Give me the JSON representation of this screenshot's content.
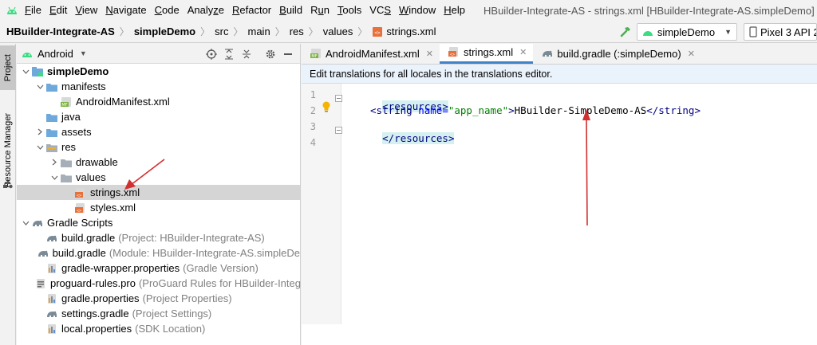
{
  "menubar": {
    "items": [
      {
        "label": "File",
        "u": "F"
      },
      {
        "label": "Edit",
        "u": "E"
      },
      {
        "label": "View",
        "u": "V"
      },
      {
        "label": "Navigate",
        "u": "N"
      },
      {
        "label": "Code",
        "u": "C"
      },
      {
        "label": "Analyze",
        "u": "z"
      },
      {
        "label": "Refactor",
        "u": "R"
      },
      {
        "label": "Build",
        "u": "B"
      },
      {
        "label": "Run",
        "u": "u"
      },
      {
        "label": "Tools",
        "u": "T"
      },
      {
        "label": "VCS",
        "u": "S"
      },
      {
        "label": "Window",
        "u": "W"
      },
      {
        "label": "Help",
        "u": "H"
      }
    ],
    "window_title": "HBuilder-Integrate-AS - strings.xml [HBuilder-Integrate-AS.simpleDemo]"
  },
  "navbar": {
    "crumbs": [
      "HBuilder-Integrate-AS",
      "simpleDemo",
      "src",
      "main",
      "res",
      "values",
      "strings.xml"
    ],
    "run_config": "simpleDemo",
    "device": "Pixel 3 API 2"
  },
  "stripe": {
    "project": "Project",
    "resource_manager": "Resource Manager"
  },
  "project_panel": {
    "view": "Android",
    "tree": [
      {
        "label": "simpleDemo",
        "level": 0,
        "arrow": "down",
        "icon": "module",
        "bold": true
      },
      {
        "label": "manifests",
        "level": 1,
        "arrow": "down",
        "icon": "folder"
      },
      {
        "label": "AndroidManifest.xml",
        "level": 2,
        "arrow": "",
        "icon": "manifest"
      },
      {
        "label": "java",
        "level": 1,
        "arrow": "",
        "icon": "folder"
      },
      {
        "label": "assets",
        "level": 1,
        "arrow": "right",
        "icon": "folder"
      },
      {
        "label": "res",
        "level": 1,
        "arrow": "down",
        "icon": "res-folder"
      },
      {
        "label": "drawable",
        "level": 2,
        "arrow": "right",
        "icon": "folder-gray"
      },
      {
        "label": "values",
        "level": 2,
        "arrow": "down",
        "icon": "folder-gray"
      },
      {
        "label": "strings.xml",
        "level": 3,
        "arrow": "",
        "icon": "xml",
        "selected": true
      },
      {
        "label": "styles.xml",
        "level": 3,
        "arrow": "",
        "icon": "xml"
      },
      {
        "label": "Gradle Scripts",
        "level": 0,
        "arrow": "down",
        "icon": "gradle"
      },
      {
        "label": "build.gradle",
        "secondary": "(Project: HBuilder-Integrate-AS)",
        "level": 1,
        "arrow": "",
        "icon": "gradle"
      },
      {
        "label": "build.gradle",
        "secondary": "(Module: HBuilder-Integrate-AS.simpleDe",
        "level": 1,
        "arrow": "",
        "icon": "gradle"
      },
      {
        "label": "gradle-wrapper.properties",
        "secondary": "(Gradle Version)",
        "level": 1,
        "arrow": "",
        "icon": "props"
      },
      {
        "label": "proguard-rules.pro",
        "secondary": "(ProGuard Rules for HBuilder-Integ",
        "level": 1,
        "arrow": "",
        "icon": "pro"
      },
      {
        "label": "gradle.properties",
        "secondary": "(Project Properties)",
        "level": 1,
        "arrow": "",
        "icon": "props"
      },
      {
        "label": "settings.gradle",
        "secondary": "(Project Settings)",
        "level": 1,
        "arrow": "",
        "icon": "gradle"
      },
      {
        "label": "local.properties",
        "secondary": "(SDK Location)",
        "level": 1,
        "arrow": "",
        "icon": "props"
      }
    ]
  },
  "editor": {
    "tabs": [
      {
        "label": "AndroidManifest.xml",
        "icon": "manifest",
        "active": false
      },
      {
        "label": "strings.xml",
        "icon": "xml",
        "active": true
      },
      {
        "label": "build.gradle (:simpleDemo)",
        "icon": "gradle",
        "active": false
      }
    ],
    "banner": "Edit translations for all locales in the translations editor.",
    "line_numbers": [
      "1",
      "2",
      "3",
      "4"
    ],
    "code": {
      "l1_tag": "<resources>",
      "l2_open": "<string ",
      "l2_attr": "name=",
      "l2_val": "\"app_name\"",
      "l2_close": ">",
      "l2_text": "HBuilder-SimpleDemo-AS",
      "l2_end": "</string>",
      "l3_tag": "</resources>"
    }
  },
  "colors": {
    "accent": "#4083c9",
    "annotation_arrow": "#d32f2f",
    "folder_blue": "#6fa9dc",
    "xml_orange": "#e8703a"
  }
}
